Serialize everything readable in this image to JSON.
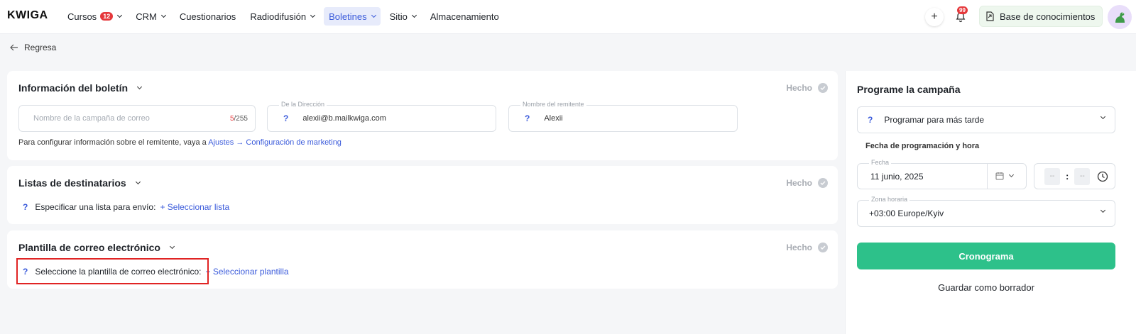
{
  "app": {
    "logo": "KWIGA"
  },
  "nav": {
    "items": [
      {
        "label": "Cursos",
        "badge": "12",
        "has_menu": true
      },
      {
        "label": "CRM",
        "has_menu": true
      },
      {
        "label": "Cuestionarios",
        "has_menu": false
      },
      {
        "label": "Radiodifusión",
        "has_menu": true
      },
      {
        "label": "Boletines",
        "has_menu": true,
        "active": true
      },
      {
        "label": "Sitio",
        "has_menu": true
      },
      {
        "label": "Almacenamiento",
        "has_menu": false
      }
    ],
    "notifications_count": "99",
    "knowledge_base": "Base de conocimientos"
  },
  "back": {
    "label": "Regresa"
  },
  "newsletter_info": {
    "title": "Información del boletín",
    "status": "Hecho",
    "campaign_name_placeholder": "Nombre de la campaña de correo",
    "char_used": "5",
    "char_limit": "/255",
    "from_address_label": "De la Dirección",
    "from_address_value": "alexii@b.mailkwiga.com",
    "sender_name_label": "Nombre del remitente",
    "sender_name_value": "Alexii",
    "help_text": "Para configurar información sobre el remitente, vaya a",
    "help_link_1": "Ajustes",
    "help_arrow": "→",
    "help_link_2": "Configuración de marketing"
  },
  "recipients": {
    "title": "Listas de destinatarios",
    "status": "Hecho",
    "prompt": "Especificar una lista para envío:",
    "action": "+ Seleccionar lista"
  },
  "template": {
    "title": "Plantilla de correo electrónico",
    "status": "Hecho",
    "prompt": "Seleccione la plantilla de correo electrónico:",
    "action": "+ Seleccionar plantilla"
  },
  "schedule": {
    "title": "Programe la campaña",
    "mode": "Programar para más tarde",
    "datetime_label": "Fecha de programación y hora",
    "date_label": "Fecha",
    "date_value": "11 junio, 2025",
    "hour_placeholder": "--",
    "minute_placeholder": "--",
    "time_separator": ":",
    "timezone_label": "Zona horaria",
    "timezone_value": "+03:00 Europe/Kyiv",
    "submit": "Cronograma",
    "draft": "Guardar como borrador"
  },
  "help_icon_glyph": "?",
  "colors": {
    "accent": "#3b5bdb",
    "success": "#2dc18a",
    "badge": "#e5383b",
    "highlight": "#e02424"
  }
}
